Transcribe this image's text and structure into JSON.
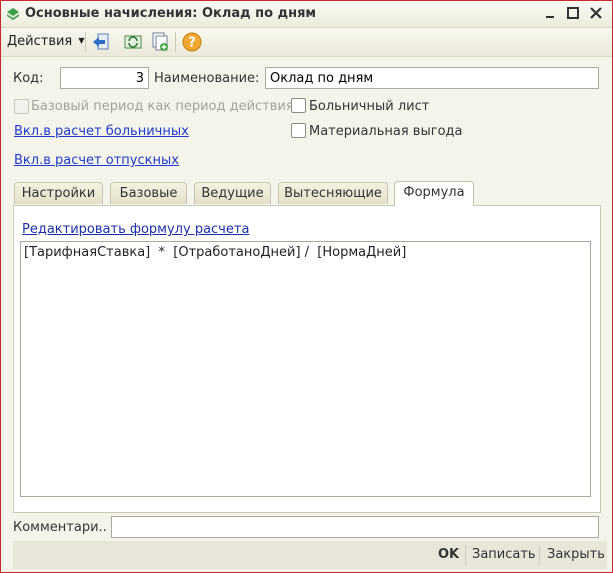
{
  "window": {
    "title": "Основные начисления: Оклад по дням",
    "minimize_icon": "minimize-icon",
    "maximize_icon": "maximize-icon",
    "close_icon": "close-icon"
  },
  "toolbar": {
    "actions_label": "Действия",
    "icons": [
      "back-arrow-icon",
      "refresh-icon",
      "copy-add-icon",
      "help-icon"
    ]
  },
  "form": {
    "code_label": "Код:",
    "code_value": "3",
    "name_label": "Наименование:",
    "name_value": "Оклад по дням",
    "base_period_label": "Базовый период как период действия",
    "sick_leave_label": "Больничный лист",
    "material_benefit_label": "Материальная выгода",
    "link_sick": "Вкл.в расчет больничных",
    "link_vacation": "Вкл.в расчет отпускных"
  },
  "tabs": [
    {
      "label": "Настройки"
    },
    {
      "label": "Базовые"
    },
    {
      "label": "Ведущие"
    },
    {
      "label": "Вытесняющие"
    },
    {
      "label": "Формула"
    }
  ],
  "formula": {
    "edit_link": "Редактировать формулу расчета",
    "text": "[ТарифнаяСтавка]  *  [ОтработаноДней] /  [НормаДней]"
  },
  "comment": {
    "label": "Комментари..",
    "value": ""
  },
  "footer": {
    "ok": "OK",
    "save": "Записать",
    "close": "Закрыть"
  },
  "colors": {
    "accent_border": "#c8272e",
    "link": "#1d3bd0",
    "help_icon": "#f0a830"
  }
}
